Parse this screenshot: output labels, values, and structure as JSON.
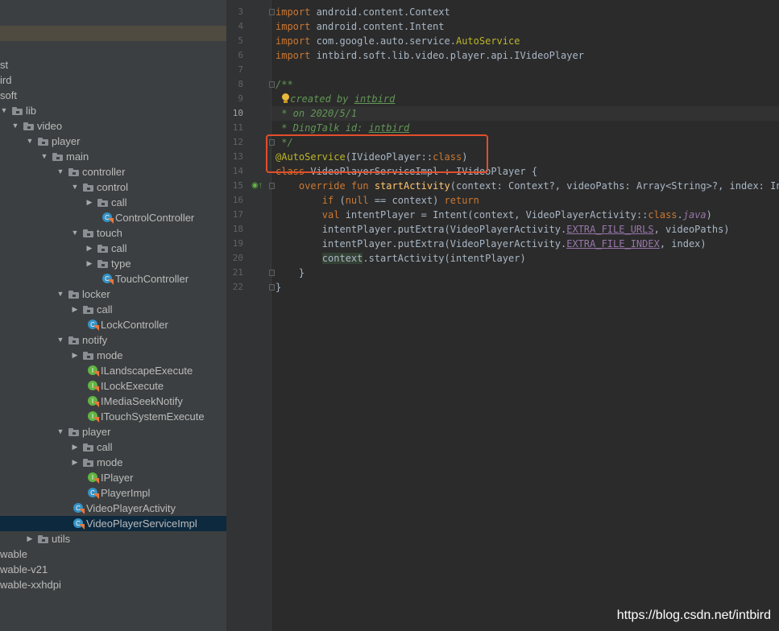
{
  "project_tree": {
    "rows": [
      {
        "label": "st",
        "type": "text",
        "indent": 0
      },
      {
        "label": "ird",
        "type": "text",
        "indent": 0
      },
      {
        "label": "soft",
        "type": "text",
        "indent": 0
      },
      {
        "label": "lib",
        "type": "folder",
        "indent": 1,
        "expanded": true
      },
      {
        "label": "video",
        "type": "folder",
        "indent": 2,
        "expanded": true
      },
      {
        "label": "player",
        "type": "folder",
        "indent": 3,
        "expanded": true
      },
      {
        "label": "main",
        "type": "folder",
        "indent": 4,
        "expanded": true
      },
      {
        "label": "controller",
        "type": "folder",
        "indent": 5,
        "expanded": true
      },
      {
        "label": "control",
        "type": "folder",
        "indent": 6,
        "expanded": true
      },
      {
        "label": "call",
        "type": "folder",
        "indent": 7,
        "expanded": false
      },
      {
        "label": "ControlController",
        "type": "kotlin",
        "indent": 8
      },
      {
        "label": "touch",
        "type": "folder",
        "indent": 6,
        "expanded": true
      },
      {
        "label": "call",
        "type": "folder",
        "indent": 7,
        "expanded": false
      },
      {
        "label": "type",
        "type": "folder",
        "indent": 7,
        "expanded": false
      },
      {
        "label": "TouchController",
        "type": "kotlin",
        "indent": 8
      },
      {
        "label": "locker",
        "type": "folder",
        "indent": 5,
        "expanded": true
      },
      {
        "label": "call",
        "type": "folder",
        "indent": 6,
        "expanded": false
      },
      {
        "label": "LockController",
        "type": "kotlin",
        "indent": 7
      },
      {
        "label": "notify",
        "type": "folder",
        "indent": 5,
        "expanded": true
      },
      {
        "label": "mode",
        "type": "folder",
        "indent": 6,
        "expanded": false
      },
      {
        "label": "ILandscapeExecute",
        "type": "kotlin-interface",
        "indent": 7
      },
      {
        "label": "ILockExecute",
        "type": "kotlin-interface",
        "indent": 7
      },
      {
        "label": "IMediaSeekNotify",
        "type": "kotlin-interface",
        "indent": 7
      },
      {
        "label": "ITouchSystemExecute",
        "type": "kotlin-interface",
        "indent": 7
      },
      {
        "label": "player",
        "type": "folder",
        "indent": 5,
        "expanded": true
      },
      {
        "label": "call",
        "type": "folder",
        "indent": 6,
        "expanded": false
      },
      {
        "label": "mode",
        "type": "folder",
        "indent": 6,
        "expanded": false
      },
      {
        "label": "IPlayer",
        "type": "kotlin-interface",
        "indent": 7
      },
      {
        "label": "PlayerImpl",
        "type": "kotlin",
        "indent": 7
      },
      {
        "label": "VideoPlayerActivity",
        "type": "kotlin",
        "indent": 6
      },
      {
        "label": "VideoPlayerServiceImpl",
        "type": "kotlin",
        "indent": 6,
        "selected": true
      },
      {
        "label": "utils",
        "type": "folder",
        "indent": 3,
        "expanded": false
      },
      {
        "label": "wable",
        "type": "text",
        "indent": 0
      },
      {
        "label": "wable-v21",
        "type": "text",
        "indent": 0
      },
      {
        "label": "wable-xxhdpi",
        "type": "text",
        "indent": 0
      }
    ]
  },
  "editor": {
    "line_numbers": [
      "3",
      "4",
      "5",
      "6",
      "7",
      "8",
      "9",
      "10",
      "11",
      "12",
      "13",
      "14",
      "15",
      "16",
      "17",
      "18",
      "19",
      "20",
      "21",
      "22"
    ],
    "current_line": "10",
    "lines": [
      [
        {
          "t": "import",
          "c": "kw"
        },
        {
          "t": " android.content.Context",
          "c": ""
        }
      ],
      [
        {
          "t": "import",
          "c": "kw"
        },
        {
          "t": " android.content.Intent",
          "c": ""
        }
      ],
      [
        {
          "t": "import",
          "c": "kw"
        },
        {
          "t": " com.google.auto.service.",
          "c": ""
        },
        {
          "t": "AutoService",
          "c": "an"
        }
      ],
      [
        {
          "t": "import",
          "c": "kw"
        },
        {
          "t": " intbird.soft.lib.video.player.api.IVideoPlayer",
          "c": ""
        }
      ],
      [],
      [
        {
          "t": "/**",
          "c": "cm"
        }
      ],
      [
        {
          "t": " ",
          "c": "cm"
        },
        {
          "t": "",
          "c": "bulb"
        },
        {
          "t": "created by ",
          "c": "cm"
        },
        {
          "t": "intbird",
          "c": "cm ul"
        }
      ],
      [
        {
          "t": " * on 2020/5/1",
          "c": "cm"
        }
      ],
      [
        {
          "t": " * DingTalk id: ",
          "c": "cm"
        },
        {
          "t": "intbird",
          "c": "cm ul"
        }
      ],
      [
        {
          "t": " */",
          "c": "cm"
        }
      ],
      [
        {
          "t": "@AutoService",
          "c": "an"
        },
        {
          "t": "(IVideoPlayer::",
          "c": ""
        },
        {
          "t": "class",
          "c": "kw"
        },
        {
          "t": ")",
          "c": ""
        }
      ],
      [
        {
          "t": "class",
          "c": "kw"
        },
        {
          "t": " VideoPlayerServiceImpl : IVideoPlayer {",
          "c": ""
        }
      ],
      [
        {
          "t": "    ",
          "c": ""
        },
        {
          "t": "override fun",
          "c": "kw"
        },
        {
          "t": " ",
          "c": ""
        },
        {
          "t": "startActivity",
          "c": "fn"
        },
        {
          "t": "(context: Context?, videoPaths: Array<String>?, index: Int)",
          "c": ""
        }
      ],
      [
        {
          "t": "        ",
          "c": ""
        },
        {
          "t": "if",
          "c": "kw"
        },
        {
          "t": " (",
          "c": ""
        },
        {
          "t": "null",
          "c": "kw"
        },
        {
          "t": " == context) ",
          "c": ""
        },
        {
          "t": "return",
          "c": "kw"
        }
      ],
      [
        {
          "t": "        ",
          "c": ""
        },
        {
          "t": "val",
          "c": "kw"
        },
        {
          "t": " intentPlayer = Intent(context, VideoPlayerActivity::",
          "c": ""
        },
        {
          "t": "class",
          "c": "kw"
        },
        {
          "t": ".",
          "c": ""
        },
        {
          "t": "java",
          "c": "it"
        },
        {
          "t": ")",
          "c": ""
        }
      ],
      [
        {
          "t": "        intentPlayer.putExtra(VideoPlayerActivity.",
          "c": ""
        },
        {
          "t": "EXTRA_FILE_URLS",
          "c": "pur"
        },
        {
          "t": ", videoPaths)",
          "c": ""
        }
      ],
      [
        {
          "t": "        intentPlayer.putExtra(VideoPlayerActivity.",
          "c": ""
        },
        {
          "t": "EXTRA_FILE_INDEX",
          "c": "pur"
        },
        {
          "t": ", index)",
          "c": ""
        }
      ],
      [
        {
          "t": "        ",
          "c": ""
        },
        {
          "t": "context",
          "c": "ctx"
        },
        {
          "t": ".startActivity(intentPlayer)",
          "c": ""
        }
      ],
      [
        {
          "t": "    }",
          "c": ""
        }
      ],
      [
        {
          "t": "}",
          "c": ""
        }
      ]
    ]
  },
  "colors": {
    "annotation_box": "#e24e2a",
    "selection": "#0d293e"
  },
  "watermark": "https://blog.csdn.net/intbird"
}
